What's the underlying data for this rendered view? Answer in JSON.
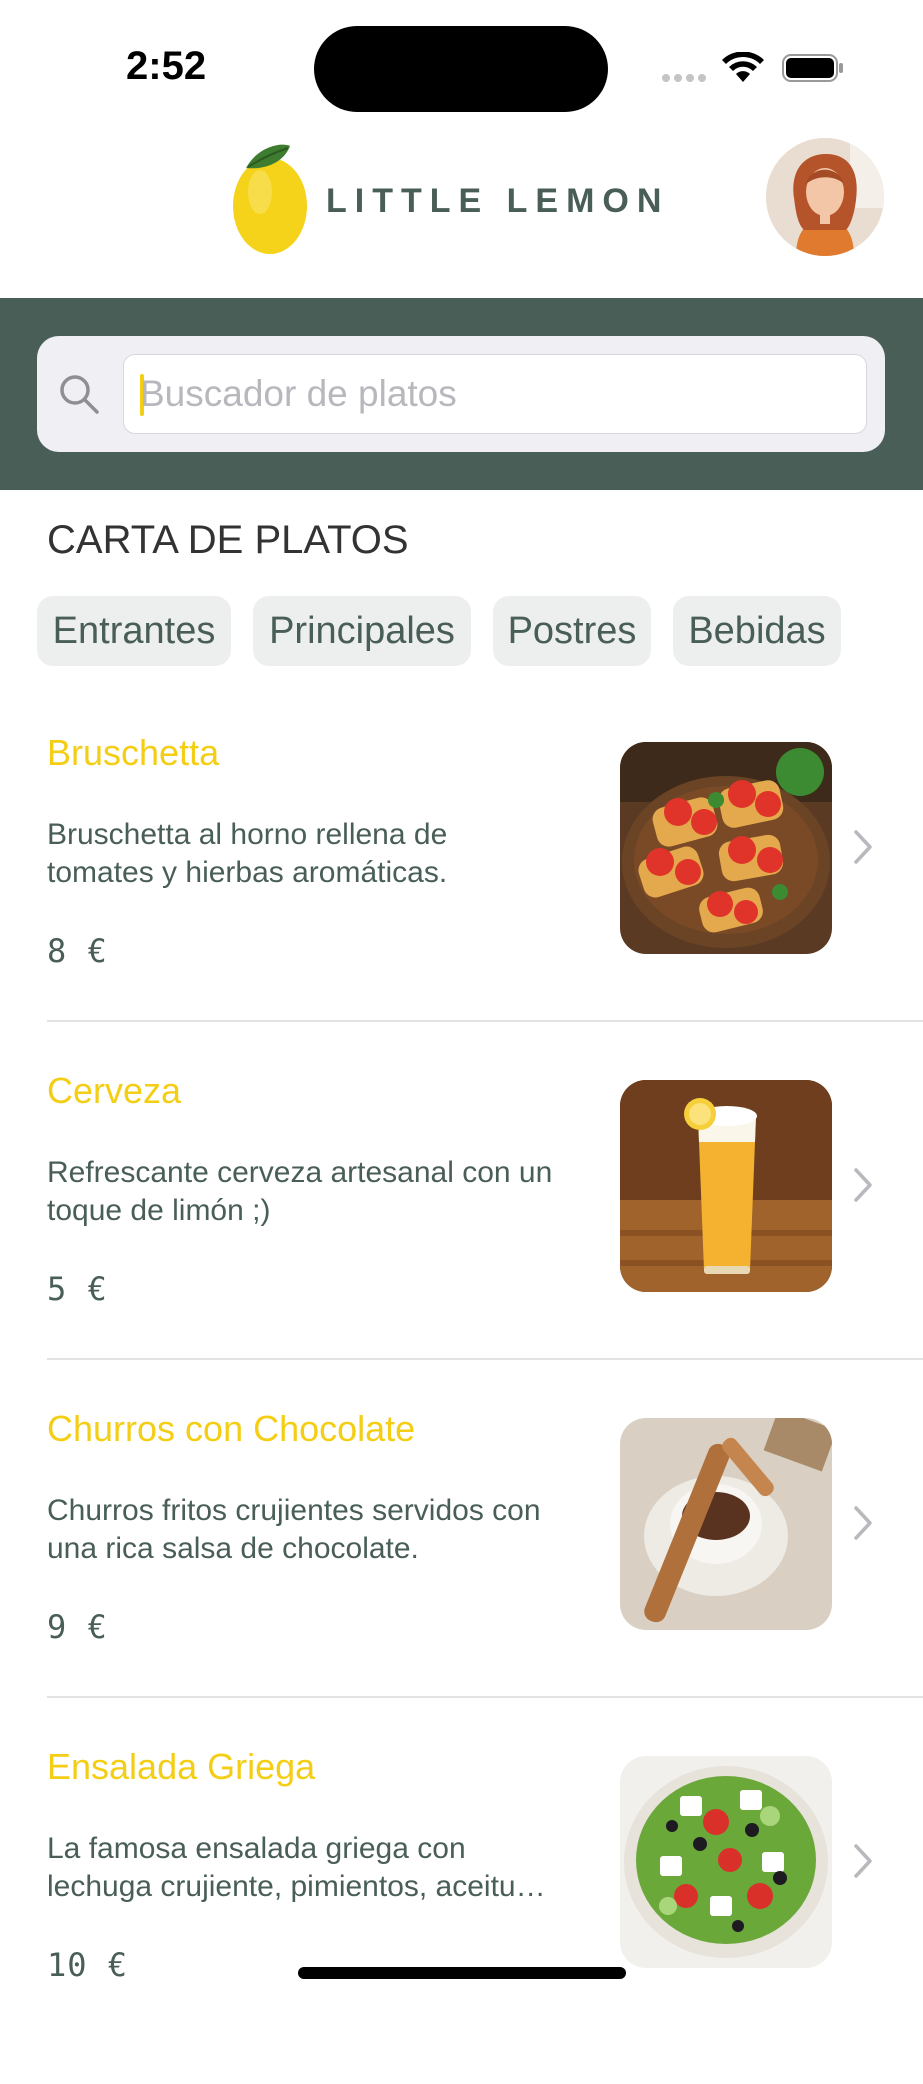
{
  "status_bar": {
    "time": "2:52"
  },
  "header": {
    "brand": "LITTLE LEMON"
  },
  "search": {
    "placeholder": "Buscador de platos",
    "value": ""
  },
  "menu": {
    "title": "CARTA DE PLATOS",
    "categories": [
      "Entrantes",
      "Principales",
      "Postres",
      "Bebidas"
    ],
    "dishes": [
      {
        "name": "Bruschetta",
        "desc_line1": "Bruschetta al horno rellena de",
        "desc_line2": "tomates y hierbas aromáticas.",
        "price": "8 €"
      },
      {
        "name": "Cerveza",
        "desc_line1": "Refrescante cerveza artesanal con un",
        "desc_line2": "toque de limón ;)",
        "price": "5 €"
      },
      {
        "name": "Churros con Chocolate",
        "desc_line1": "Churros fritos crujientes servidos con",
        "desc_line2": "una rica salsa de chocolate.",
        "price": "9 €"
      },
      {
        "name": "Ensalada Griega",
        "desc_line1": "La famosa ensalada griega con",
        "desc_line2": "lechuga crujiente, pimientos, aceitu…",
        "price": "10 €"
      }
    ]
  },
  "colors": {
    "primary_green": "#495E57",
    "lemon_yellow": "#F4CE14",
    "chip_bg": "#EDEFEE"
  }
}
